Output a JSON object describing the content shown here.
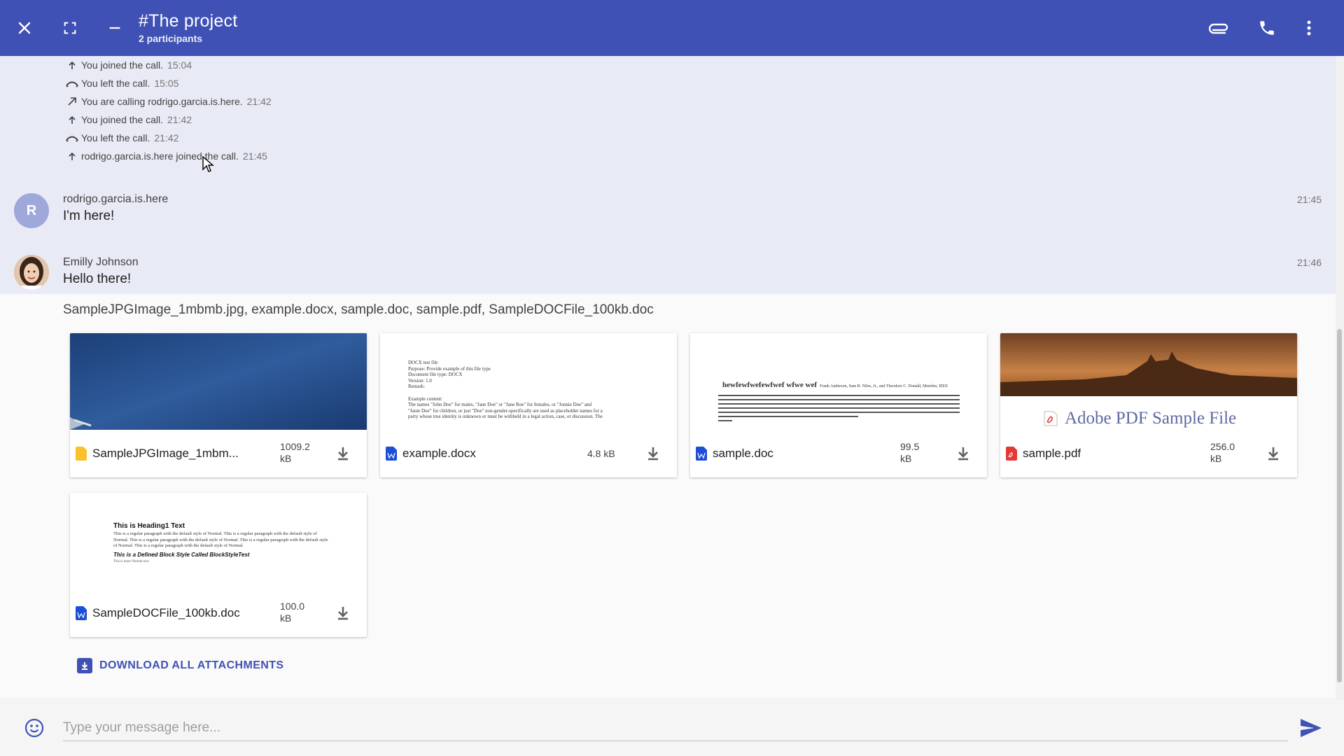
{
  "header": {
    "title": "#The project",
    "subtitle": "2 participants"
  },
  "system_events": [
    {
      "text": "You joined the call.",
      "time": "15:04",
      "icon": "call-joined-icon"
    },
    {
      "text": "You left the call.",
      "time": "15:05",
      "icon": "call-left-icon"
    },
    {
      "text": "You are calling rodrigo.garcia.is.here.",
      "time": "21:42",
      "icon": "call-outgoing-icon"
    },
    {
      "text": "You joined the call.",
      "time": "21:42",
      "icon": "call-joined-icon"
    },
    {
      "text": "You left the call.",
      "time": "21:42",
      "icon": "call-left-icon"
    },
    {
      "text": "rodrigo.garcia.is.here joined the call.",
      "time": "21:45",
      "icon": "call-joined-icon"
    }
  ],
  "messages": [
    {
      "sender": "rodrigo.garcia.is.here",
      "avatar_letter": "R",
      "text": "I'm here!",
      "time": "21:45"
    },
    {
      "sender": "Emilly Johnson",
      "text": "Hello there!",
      "time": "21:46",
      "file_list": "SampleJPGImage_1mbmb.jpg, example.docx, sample.doc, sample.pdf, SampleDOCFile_100kb.doc"
    }
  ],
  "attachments": [
    {
      "name": "SampleJPGImage_1mbm...",
      "size_line1": "1009.2",
      "size_line2": "kB",
      "type_icon": "image-file-icon",
      "type_color": "#fbc02d"
    },
    {
      "name": "example.docx",
      "size_line1": "4.8 kB",
      "size_line2": "",
      "type_icon": "word-file-icon",
      "type_color": "#1e4ed8"
    },
    {
      "name": "sample.doc",
      "size_line1": "99.5",
      "size_line2": "kB",
      "type_icon": "word-file-icon",
      "type_color": "#1e4ed8"
    },
    {
      "name": "sample.pdf",
      "size_line1": "256.0",
      "size_line2": "kB",
      "type_icon": "pdf-file-icon",
      "type_color": "#e53935"
    },
    {
      "name": "SampleDOCFile_100kb.doc",
      "size_line1": "100.0",
      "size_line2": "kB",
      "type_icon": "word-file-icon",
      "type_color": "#1e4ed8"
    }
  ],
  "thumbnails": {
    "docx_lines": [
      "DOCX test file",
      "Purpose: Provide example of this file type",
      "Document file type: DOCX",
      "Version: 1.0",
      "Remark:",
      "",
      "Example content:",
      "The names \"John Doe\" for males, \"Jane Doe\" or \"Jane Roe\" for females, or \"Jonnie Doe\" and",
      "\"Janie Doe\" for children, or just \"Doe\" non-gender-specifically are used as placeholder names for a",
      "party whose true identity is unknown or must be withheld in a legal action, case, or discussion. The"
    ],
    "doc_heading": "hewfewfwefewfwef wfwe wef",
    "doc_authors": "Frank Anderson, Sam B. Niles, Jr., and Theodore C. Donald, Member, IEEE",
    "pdf_title": "Adobe PDF Sample File",
    "docfile_heading": "This is Heading1 Text",
    "docfile_para": "This is a regular paragraph with the default style of Normal. This is a regular paragraph with the default style of Normal. This is a regular paragraph with the default style of Normal. This is a regular paragraph with the default style of Normal. This is a regular paragraph with the default style of Normal.",
    "docfile_block": "This is a Defined Block Style Called BlockStyleTest",
    "docfile_footer": "This is more Normal text."
  },
  "download_all_label": "DOWNLOAD ALL ATTACHMENTS",
  "composer": {
    "placeholder": "Type your message here..."
  },
  "colors": {
    "header_bg": "#3f51b5",
    "highlight_bg": "#e8eaf6",
    "accent": "#3f51b5"
  }
}
